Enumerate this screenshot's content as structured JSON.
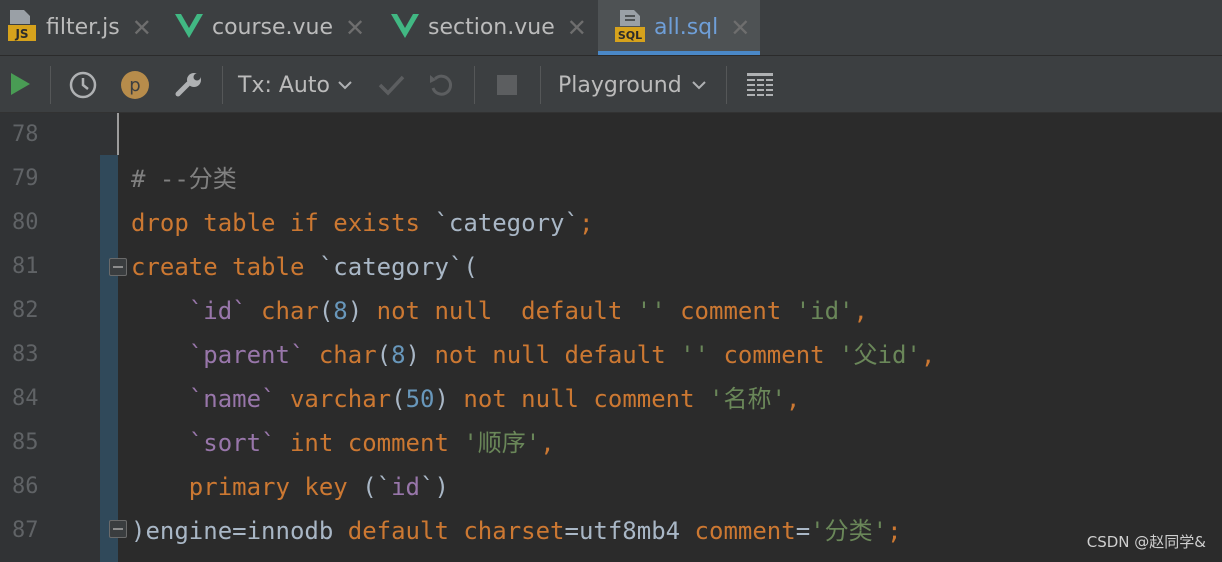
{
  "tabs": [
    {
      "label": "filter.js",
      "icon": "js-file-icon",
      "close": "✕"
    },
    {
      "label": "course.vue",
      "icon": "vue-file-icon",
      "close": "✕"
    },
    {
      "label": "section.vue",
      "icon": "vue-file-icon",
      "close": "✕"
    },
    {
      "label": "all.sql",
      "icon": "sql-file-icon",
      "close": "✕",
      "active": true
    }
  ],
  "file_badges": {
    "js": "JS",
    "sql": "SQL"
  },
  "toolbar": {
    "tx_label": "Tx: Auto",
    "session_label": "Playground",
    "history_badge": "p"
  },
  "editor": {
    "line_numbers": [
      "78",
      "79",
      "80",
      "81",
      "82",
      "83",
      "84",
      "85",
      "86",
      "87"
    ],
    "lines": [
      [],
      [
        [
          "cm",
          "# --分类"
        ]
      ],
      [
        [
          "k",
          "drop table if exists "
        ],
        [
          "pl",
          "`category`"
        ],
        [
          "k",
          ";"
        ]
      ],
      [
        [
          "k",
          "create table "
        ],
        [
          "pl",
          "`category`("
        ]
      ],
      [
        [
          "pl",
          "    "
        ],
        [
          "id",
          "`id`"
        ],
        [
          "pl",
          " "
        ],
        [
          "k",
          "char"
        ],
        [
          "pl",
          "("
        ],
        [
          "num",
          "8"
        ],
        [
          "pl",
          ") "
        ],
        [
          "k",
          "not null  default "
        ],
        [
          "str",
          "''"
        ],
        [
          "k",
          " comment "
        ],
        [
          "str",
          "'id'"
        ],
        [
          "k",
          ","
        ]
      ],
      [
        [
          "pl",
          "    "
        ],
        [
          "id",
          "`parent`"
        ],
        [
          "pl",
          " "
        ],
        [
          "k",
          "char"
        ],
        [
          "pl",
          "("
        ],
        [
          "num",
          "8"
        ],
        [
          "pl",
          ") "
        ],
        [
          "k",
          "not null default "
        ],
        [
          "str",
          "''"
        ],
        [
          "k",
          " comment "
        ],
        [
          "str",
          "'父id'"
        ],
        [
          "k",
          ","
        ]
      ],
      [
        [
          "pl",
          "    "
        ],
        [
          "id",
          "`name`"
        ],
        [
          "pl",
          " "
        ],
        [
          "k",
          "varchar"
        ],
        [
          "pl",
          "("
        ],
        [
          "num",
          "50"
        ],
        [
          "pl",
          ") "
        ],
        [
          "k",
          "not null comment "
        ],
        [
          "str",
          "'名称'"
        ],
        [
          "k",
          ","
        ]
      ],
      [
        [
          "pl",
          "    "
        ],
        [
          "id",
          "`sort`"
        ],
        [
          "pl",
          " "
        ],
        [
          "k",
          "int comment "
        ],
        [
          "str",
          "'顺序'"
        ],
        [
          "k",
          ","
        ]
      ],
      [
        [
          "pl",
          "    "
        ],
        [
          "k",
          "primary key "
        ],
        [
          "pl",
          "(`"
        ],
        [
          "id",
          "id"
        ],
        [
          "pl",
          "`)"
        ]
      ],
      [
        [
          "pl",
          ")engine=innodb "
        ],
        [
          "k",
          "default "
        ],
        [
          "k",
          "charset"
        ],
        [
          "pl",
          "=utf8mb4 "
        ],
        [
          "k",
          "comment"
        ],
        [
          "pl",
          "="
        ],
        [
          "str",
          "'分类'"
        ],
        [
          "k",
          ";"
        ]
      ]
    ]
  },
  "watermark": "CSDN @赵同学&",
  "colors": {
    "background": "#2b2b2b",
    "keyword": "#cc7832",
    "identifier": "#9876aa",
    "string": "#6a8759",
    "number": "#6897bb",
    "comment": "#808080",
    "active_tab_accent": "#4a88c7",
    "vue_green": "#41b883",
    "run_green": "#499c54"
  }
}
